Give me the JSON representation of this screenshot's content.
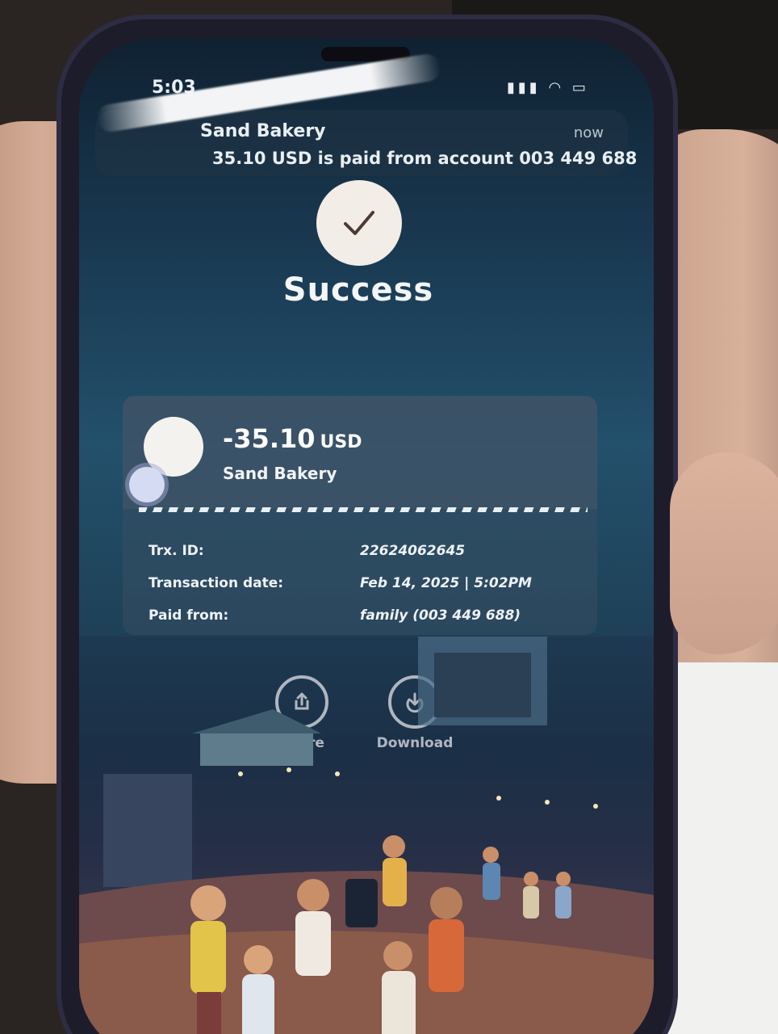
{
  "status_bar": {
    "time": "5:03"
  },
  "notification": {
    "title": "Sand Bakery",
    "time": "now",
    "body": "35.10 USD is paid from account 003 449 688"
  },
  "result": {
    "title": "Success"
  },
  "transaction": {
    "amount": "-35.10",
    "currency": "USD",
    "merchant": "Sand Bakery",
    "details": [
      {
        "label": "Trx. ID:",
        "value": "22624062645"
      },
      {
        "label": "Transaction date:",
        "value": "Feb 14, 2025 | 5:02PM"
      },
      {
        "label": "Paid from:",
        "value": "family (003 449 688)"
      }
    ]
  },
  "actions": {
    "share_label": "Share",
    "download_label": "Download"
  },
  "colors": {
    "accent": "#f2ede6",
    "text": "#ffffff",
    "background_top": "#0f2131"
  }
}
